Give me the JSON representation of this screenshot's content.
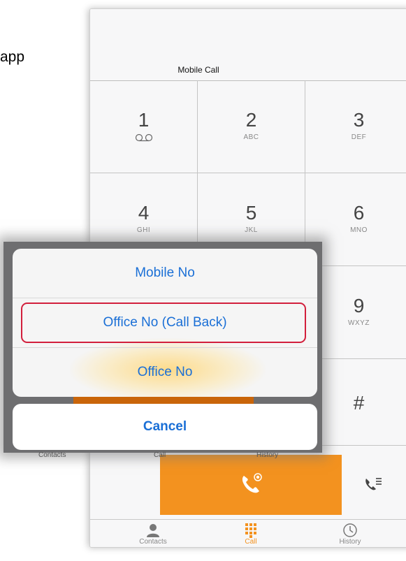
{
  "document": {
    "fragment_text": "app"
  },
  "dialer": {
    "line_label": "Mobile Call",
    "keys": [
      {
        "digit": "1",
        "letters": ""
      },
      {
        "digit": "2",
        "letters": "ABC"
      },
      {
        "digit": "3",
        "letters": "DEF"
      },
      {
        "digit": "4",
        "letters": "GHI"
      },
      {
        "digit": "5",
        "letters": "JKL"
      },
      {
        "digit": "6",
        "letters": "MNO"
      },
      {
        "digit": "9",
        "letters": "WXYZ"
      },
      {
        "digit": "#",
        "letters": ""
      }
    ]
  },
  "action_sheet": {
    "options": [
      "Mobile No",
      "Office No (Call Back)",
      "Office No"
    ],
    "cancel_label": "Cancel",
    "highlighted_option": "Office No (Call Back)"
  },
  "partially_hidden_labels": {
    "contacts": "Contacts",
    "call": "Call",
    "history": "History"
  },
  "tabbar": {
    "tabs": [
      {
        "label": "Contacts",
        "icon": "person-icon"
      },
      {
        "label": "Call",
        "icon": "keypad-icon"
      },
      {
        "label": "History",
        "icon": "clock-icon"
      }
    ],
    "active": "Call"
  },
  "colors": {
    "accent": "#f3921f",
    "link": "#1a6fd6",
    "highlight_border": "#d21f3c"
  }
}
